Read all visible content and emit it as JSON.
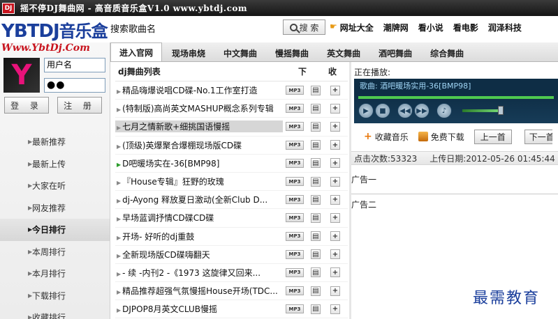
{
  "window": {
    "badge": "DJ",
    "title": "摇不停DJ舞曲网 - 高音质音乐盒V1.0  www.ybtdj.com"
  },
  "header": {
    "logo_text": "YBTDJ",
    "logo_cn": "音乐盒",
    "search_title": "搜索歌曲名",
    "search_button": "搜 索",
    "links": [
      "网址大全",
      "潮牌网",
      "看小说",
      "看电影",
      "润泽科技"
    ]
  },
  "sidebar": {
    "site_url": "Www.YbtDj.Com",
    "avatar_letter": "Y",
    "username_value": "用户名",
    "password_value": "●●",
    "login_label": "登 录",
    "register_label": "注 册",
    "items": [
      {
        "label": "最新推荐",
        "active": false
      },
      {
        "label": "最新上传",
        "active": false
      },
      {
        "label": "大家在听",
        "active": false
      },
      {
        "label": "网友推荐",
        "active": false
      },
      {
        "label": "今日排行",
        "active": true
      },
      {
        "label": "本周排行",
        "active": false
      },
      {
        "label": "本月排行",
        "active": false
      },
      {
        "label": "下载排行",
        "active": false
      },
      {
        "label": "收藏排行",
        "active": false
      }
    ]
  },
  "tabs": [
    {
      "label": "进入官网",
      "active": true
    },
    {
      "label": "现场串烧",
      "active": false
    },
    {
      "label": "中文舞曲",
      "active": false
    },
    {
      "label": "慢摇舞曲",
      "active": false
    },
    {
      "label": "英文舞曲",
      "active": false
    },
    {
      "label": "酒吧舞曲",
      "active": false
    },
    {
      "label": "综合舞曲",
      "active": false
    }
  ],
  "song_list": {
    "header_title": "dj舞曲列表",
    "header_download": "下",
    "header_favorite": "收",
    "mp3_label": "MP3",
    "download_glyph": "▤",
    "favorite_glyph": "+",
    "songs": [
      {
        "name": "精品嗨爆说唱CD碟-No.1工作室打造",
        "state": "normal"
      },
      {
        "name": "(特制版)高尚英文MASHUP概念系列专辑",
        "state": "normal"
      },
      {
        "name": "七月之情新歌+细挑国语慢摇",
        "state": "selected"
      },
      {
        "name": "(顶级)英爆聚合爆棚现场版CD碟",
        "state": "normal"
      },
      {
        "name": "D吧暖场实在-36[BMP98]",
        "state": "playing"
      },
      {
        "name": "『House专辑』狂野的玫瑰",
        "state": "normal"
      },
      {
        "name": "dj-Ayong 释放夏日激动(全新Club D...",
        "state": "normal"
      },
      {
        "name": "早场蓝调抒情CD碟CD碟",
        "state": "normal"
      },
      {
        "name": "开场- 好听的dj重鼓",
        "state": "normal"
      },
      {
        "name": "全新现场版CD碟嗨翻天",
        "state": "normal"
      },
      {
        "name": "- 续 -内刊2 -《1973 这旋律又回来...",
        "state": "normal"
      },
      {
        "name": "精品推荐超强气氛慢摇House开场(TDC...",
        "state": "normal"
      },
      {
        "name": "DJPOP8月英文CLUB慢摇",
        "state": "normal"
      }
    ]
  },
  "player": {
    "now_playing_label": "正在播放:",
    "now_playing_text": "歌曲: 酒吧暖场实用-36[BMP98]",
    "progress": 1.0,
    "volume": 0.95,
    "favorite_label": "收藏音乐",
    "download_label": "免费下载",
    "prev_label": "上一首",
    "next_label": "下一首",
    "clicks_label": "点击次数:53323",
    "upload_label": "上传日期:2012-05-26 01:45:44",
    "ad1": "广告一",
    "ad2": "广告二"
  },
  "watermark": "最需教育",
  "colors": {
    "accent": "#1b3f9c",
    "title_bar": "#151515",
    "brand_red": "#c8141e",
    "player_bg": "#0e2d45",
    "progress_green": "#4fc94f"
  }
}
